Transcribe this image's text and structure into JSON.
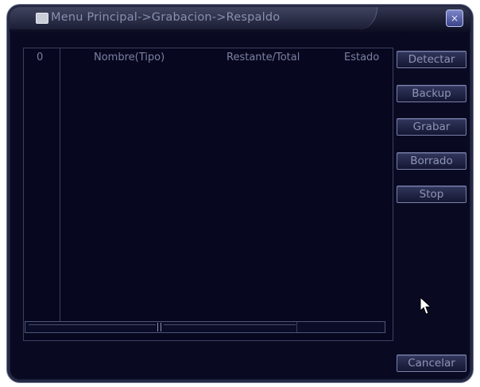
{
  "window": {
    "title": "Menu Principal->Grabacion->Respaldo",
    "close_glyph": "×"
  },
  "table": {
    "columns": [
      "0",
      "Nombre(Tipo)",
      "Restante/Total",
      "Estado"
    ],
    "rows": []
  },
  "buttons": {
    "detect": "Detectar",
    "backup": "Backup",
    "record": "Grabar",
    "erase": "Borrado",
    "stop": "Stop",
    "cancel": "Cancelar"
  },
  "icons": {
    "title_icon": "folder-icon",
    "close_icon": "close-icon",
    "cursor": "mouse-pointer-icon"
  },
  "colors": {
    "background": "#090a22",
    "text": "#8f94b4",
    "border": "#7a80a8"
  }
}
